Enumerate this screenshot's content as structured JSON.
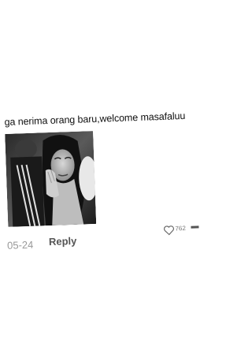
{
  "comment": {
    "text": "ga nerima orang baru,welcome masafaluu",
    "image_description_icon": "photo-attachment",
    "timestamp": "05-24",
    "reply_label": "Reply",
    "like_count": "762",
    "like_icon": "heart-outline-icon"
  }
}
